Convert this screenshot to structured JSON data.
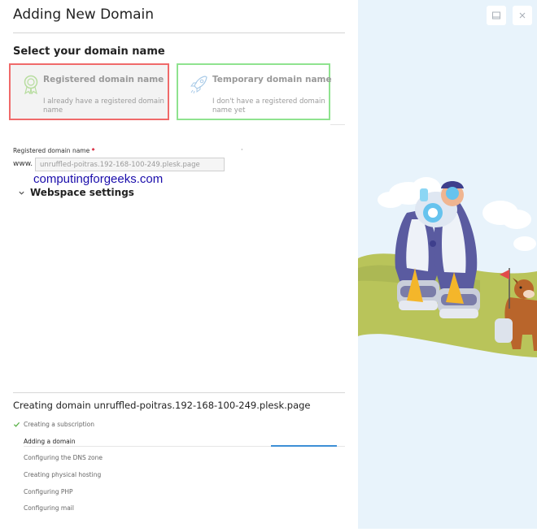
{
  "dialog": {
    "title": "Adding New Domain",
    "section_heading": "Select your domain name"
  },
  "options": [
    {
      "title": "Registered domain name",
      "description": "I already have a registered domain name"
    },
    {
      "title": "Temporary domain name",
      "description": "I don't have a registered domain name yet"
    }
  ],
  "form": {
    "field_label": "Registered domain name",
    "required_mark": "*",
    "dot": "·",
    "prefix": "www.",
    "input_value": "unruffled-poitras.192-168-100-249.plesk.page",
    "overlay_text": "computingforgeeks.com",
    "webspace_label": "Webspace settings"
  },
  "progress": {
    "title": "Creating domain unruffled-poitras.192-168-100-249.plesk.page",
    "steps": [
      {
        "label": "Creating a subscription",
        "status": "done"
      },
      {
        "label": "Adding a domain",
        "status": "in-progress",
        "progress": 0.2
      },
      {
        "label": "Configuring the DNS zone",
        "status": "pending"
      },
      {
        "label": "Creating physical hosting",
        "status": "pending"
      },
      {
        "label": "Configuring PHP",
        "status": "pending"
      },
      {
        "label": "Configuring mail",
        "status": "pending"
      }
    ]
  },
  "window": {
    "icons": [
      "expand-icon",
      "close-icon"
    ]
  },
  "colors": {
    "registered_outline": "#f06a6a",
    "temporary_outline": "#8fe38f",
    "link_blue": "#1a0dab",
    "progress_blue": "#3d8fd6",
    "illustration_bg": "#e8f3fb"
  }
}
